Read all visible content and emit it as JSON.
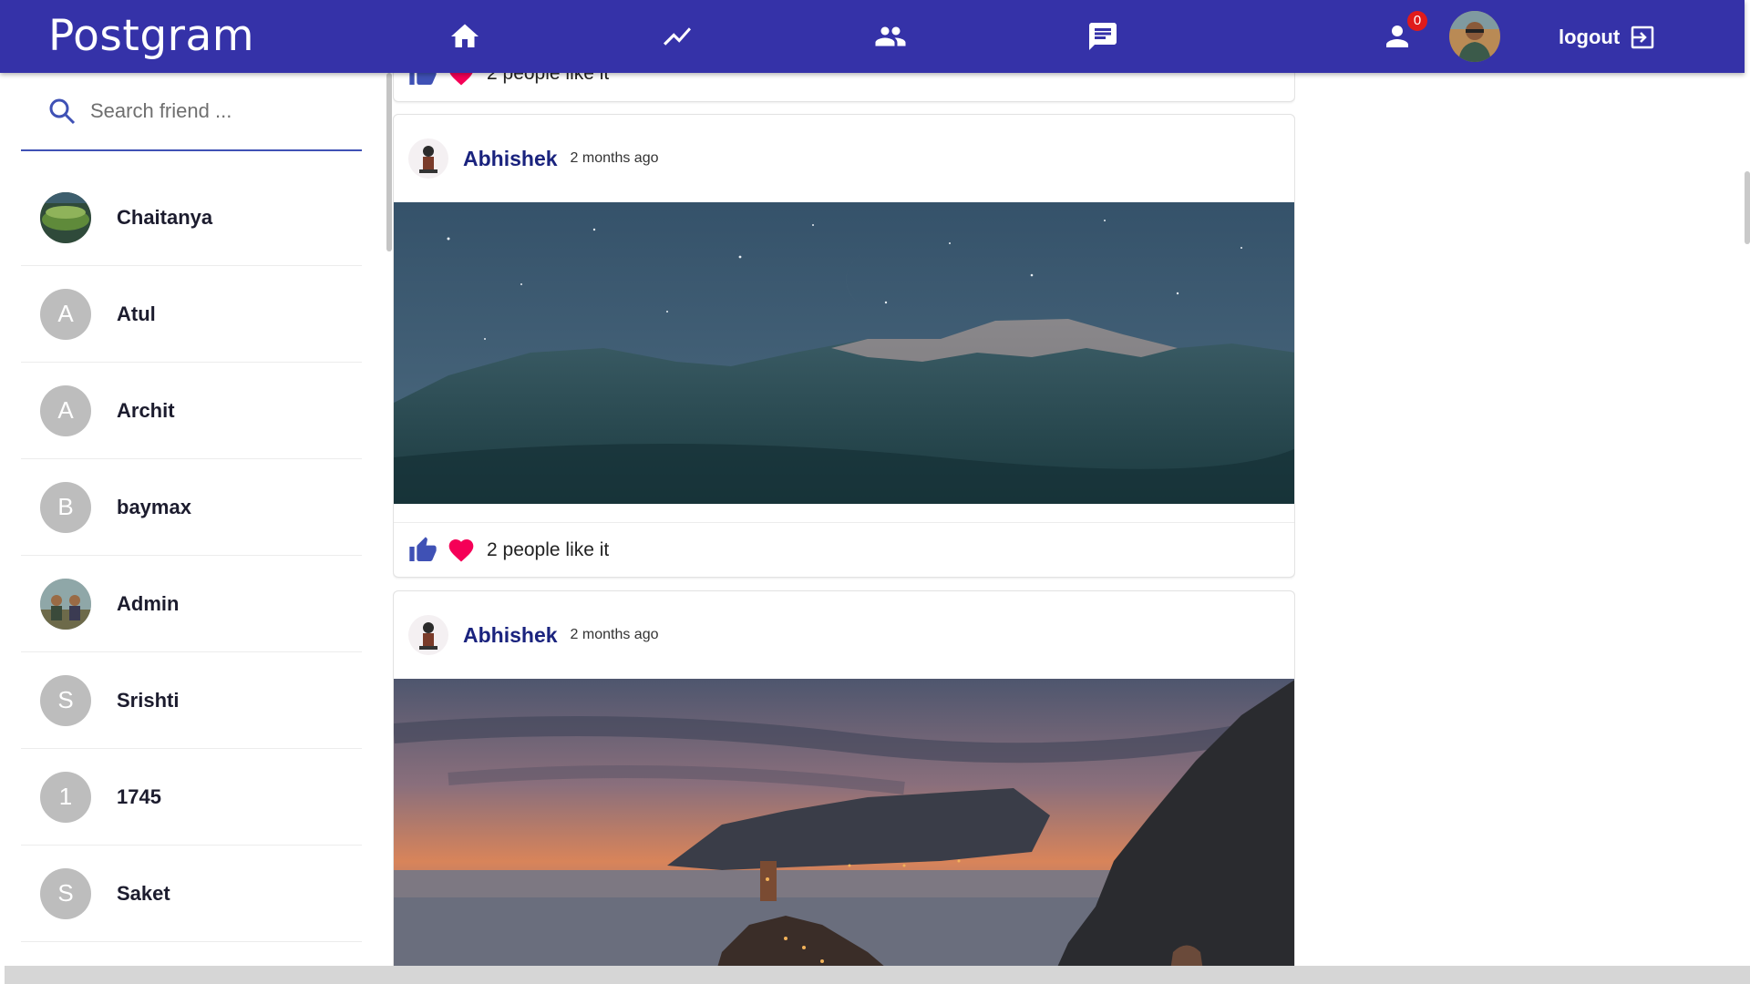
{
  "app": {
    "brand": "Postgram"
  },
  "nav": {
    "icons": [
      "home-icon",
      "trending-icon",
      "people-icon",
      "chat-icon"
    ],
    "notification_count": "0",
    "logout_label": "logout"
  },
  "search": {
    "placeholder": "Search friend ..."
  },
  "friends": [
    {
      "name": "Chaitanya",
      "initial": ""
    },
    {
      "name": "Atul",
      "initial": "A"
    },
    {
      "name": "Archit",
      "initial": "A"
    },
    {
      "name": "baymax",
      "initial": "B"
    },
    {
      "name": "Admin",
      "initial": ""
    },
    {
      "name": "Srishti",
      "initial": "S"
    },
    {
      "name": "1745",
      "initial": "1"
    },
    {
      "name": "Saket",
      "initial": "S"
    }
  ],
  "posts": [
    {
      "author": "",
      "time": "",
      "likes": "2 people like it"
    },
    {
      "author": "Abhishek",
      "time": "2 months ago",
      "likes": "2 people like it"
    },
    {
      "author": "Abhishek",
      "time": "2 months ago",
      "likes": ""
    }
  ],
  "colors": {
    "appbar": "#3532a8",
    "accent": "#3f51b5",
    "like": "#3f51b5",
    "heart": "#f50057",
    "author": "#1a237e"
  }
}
